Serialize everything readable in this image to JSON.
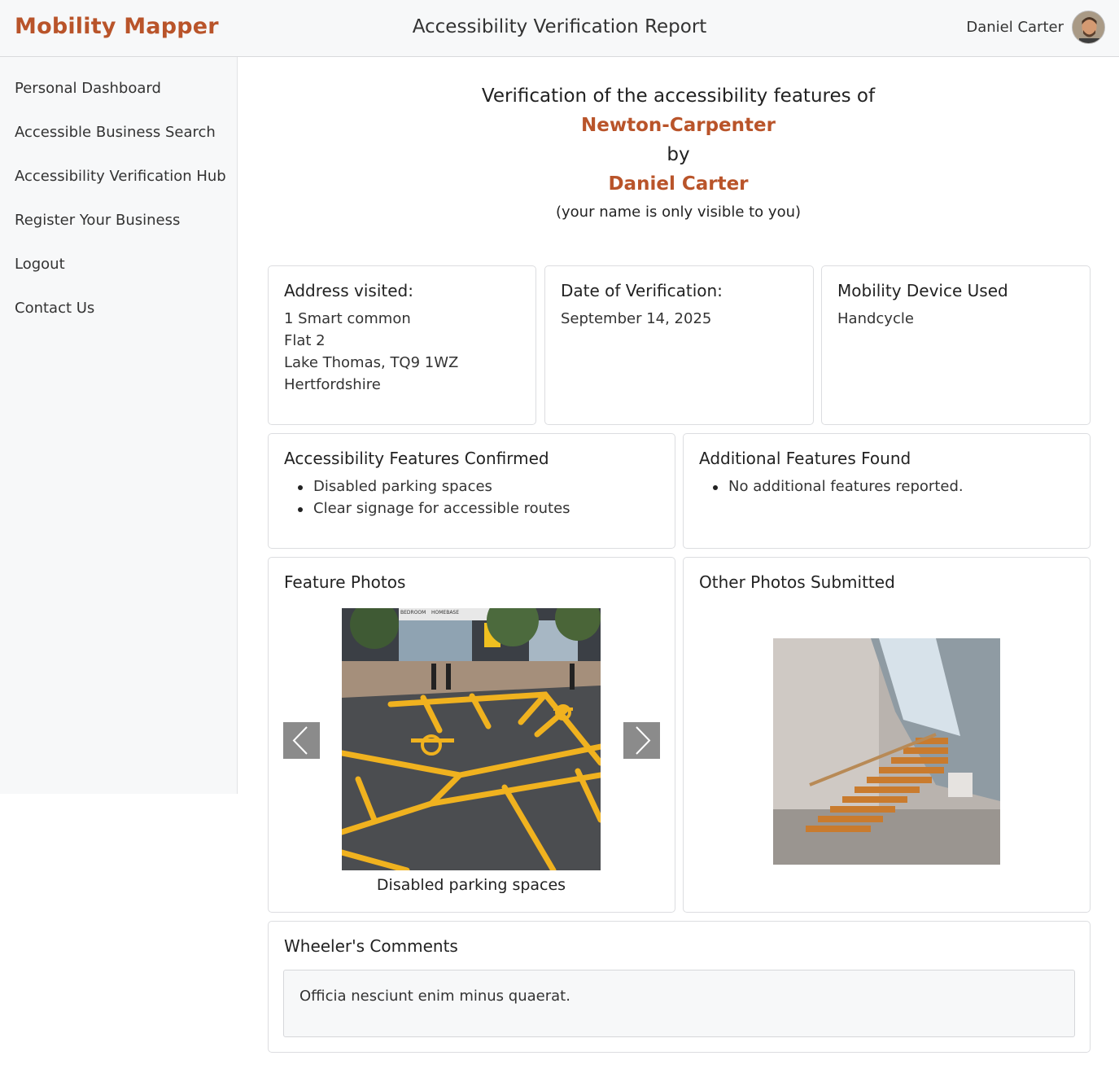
{
  "app": {
    "brand": "Mobility Mapper",
    "page_title": "Accessibility Verification Report",
    "user_name": "Daniel Carter"
  },
  "sidebar": {
    "items": [
      {
        "label": "Personal Dashboard"
      },
      {
        "label": "Accessible Business Search"
      },
      {
        "label": "Accessibility Verification Hub"
      },
      {
        "label": "Register Your Business"
      },
      {
        "label": "Logout"
      },
      {
        "label": "Contact Us"
      }
    ]
  },
  "hero": {
    "line1": "Verification of the accessibility features of",
    "business": "Newton-Carpenter",
    "by": "by",
    "verifier": "Daniel Carter",
    "note": "(your name is only visible to you)"
  },
  "address_card": {
    "title": "Address visited:",
    "lines": [
      "1 Smart common",
      "Flat 2",
      "Lake Thomas, TQ9 1WZ",
      "Hertfordshire"
    ]
  },
  "date_card": {
    "title": "Date of Verification:",
    "value": "September 14, 2025"
  },
  "device_card": {
    "title": "Mobility Device Used",
    "value": "Handcycle"
  },
  "features_card": {
    "title": "Accessibility Features Confirmed",
    "items": [
      "Disabled parking spaces",
      "Clear signage for accessible routes"
    ]
  },
  "additional_card": {
    "title": "Additional Features Found",
    "items": [
      "No additional features reported."
    ]
  },
  "feature_photos": {
    "title": "Feature Photos",
    "caption": "Disabled parking spaces",
    "photo_sign_texts": [
      "BEDROOM",
      "HOMEBASE"
    ]
  },
  "other_photos": {
    "title": "Other Photos Submitted"
  },
  "comments": {
    "title": "Wheeler's Comments",
    "text": "Officia nesciunt enim minus quaerat."
  },
  "colors": {
    "accent": "#b9542a",
    "sidebar_bg": "#f7f8f9",
    "card_border": "#dcdde0",
    "carousel_button": "#8b8b8b"
  },
  "icons": {
    "prev": "chevron-left-icon",
    "next": "chevron-right-icon"
  }
}
